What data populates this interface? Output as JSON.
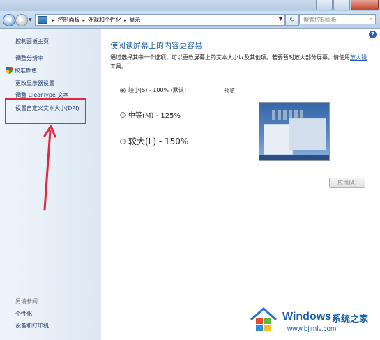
{
  "address": {
    "crumbs": [
      "控制面板",
      "外观和个性化",
      "显示"
    ],
    "search_placeholder": "搜索控制面板"
  },
  "sidebar": {
    "links": [
      "控制面板主页",
      "调整分辨率",
      "校准颜色",
      "更改显示器设置",
      "调整 ClearType 文本",
      "设置自定义文本大小(DPI)"
    ],
    "see_also_title": "另请参阅",
    "see_also": [
      "个性化",
      "设备和打印机"
    ]
  },
  "main": {
    "title": "使阅读屏幕上的内容更容易",
    "desc_prefix": "通过选择其中一个选项，可以更改屏幕上的文本大小以及其他项。若要暂时放大部分屏幕，请使用",
    "desc_link": "放大镜",
    "desc_suffix": "工具。",
    "options": [
      {
        "label": "较小(S) - 100% (默认)",
        "checked": true
      },
      {
        "label": "中等(M) - 125%",
        "checked": false
      },
      {
        "label": "较大(L) - 150%",
        "checked": false
      }
    ],
    "preview_label": "预览",
    "apply_label": "应用(A)"
  },
  "watermark": {
    "brand": "Windows",
    "brand_cn": "系统之家",
    "url": "www.bjjmlv.com"
  },
  "colors": {
    "accent": "#1f5fa6",
    "annotation": "#e0283c"
  }
}
